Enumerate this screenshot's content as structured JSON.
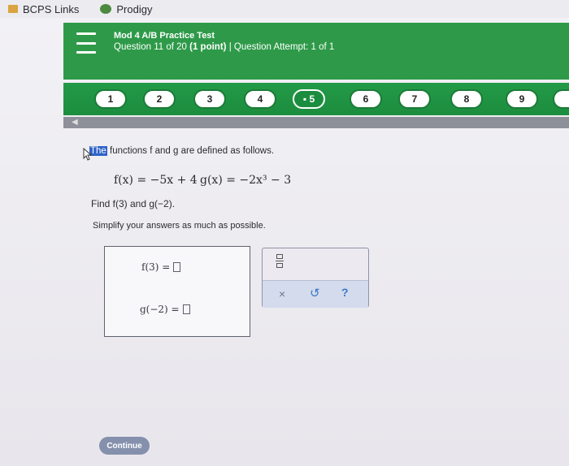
{
  "bookmarks": {
    "items": [
      {
        "label": "BCPS Links",
        "icon": "folder-icon"
      },
      {
        "label": "Prodigy",
        "icon": "prodigy-icon"
      }
    ]
  },
  "header": {
    "test_title": "Mod 4 A/B Practice Test",
    "question_text": "Question 11 of 20",
    "points_text": "(1 point)",
    "separator": "|",
    "attempt_text": "Question Attempt: 1 of 1"
  },
  "question_nav": {
    "items": [
      "1",
      "2",
      "3",
      "4",
      "5",
      "6",
      "7",
      "8",
      "9"
    ],
    "current_marker": "▪ 5"
  },
  "question": {
    "intro_highlight": "The",
    "intro_rest": "functions f and g are defined as follows.",
    "f_def": "f(x) = −5x + 4",
    "g_def": "g(x) = −2x³ − 3",
    "find_text": "Find f(3) and g(−2).",
    "simplify_text": "Simplify your answers as much as possible."
  },
  "answer": {
    "f_label": "f(3) =",
    "g_label": "g(−2) ="
  },
  "tools": {
    "x_label": "×",
    "undo_label": "↺",
    "help_label": "?"
  },
  "footer": {
    "continue_label": "Continue"
  },
  "colors": {
    "header_green": "#2e9a49",
    "nav_green": "#1c8d3e",
    "highlight_blue": "#2f63c7",
    "button_slate": "#8590ad"
  }
}
